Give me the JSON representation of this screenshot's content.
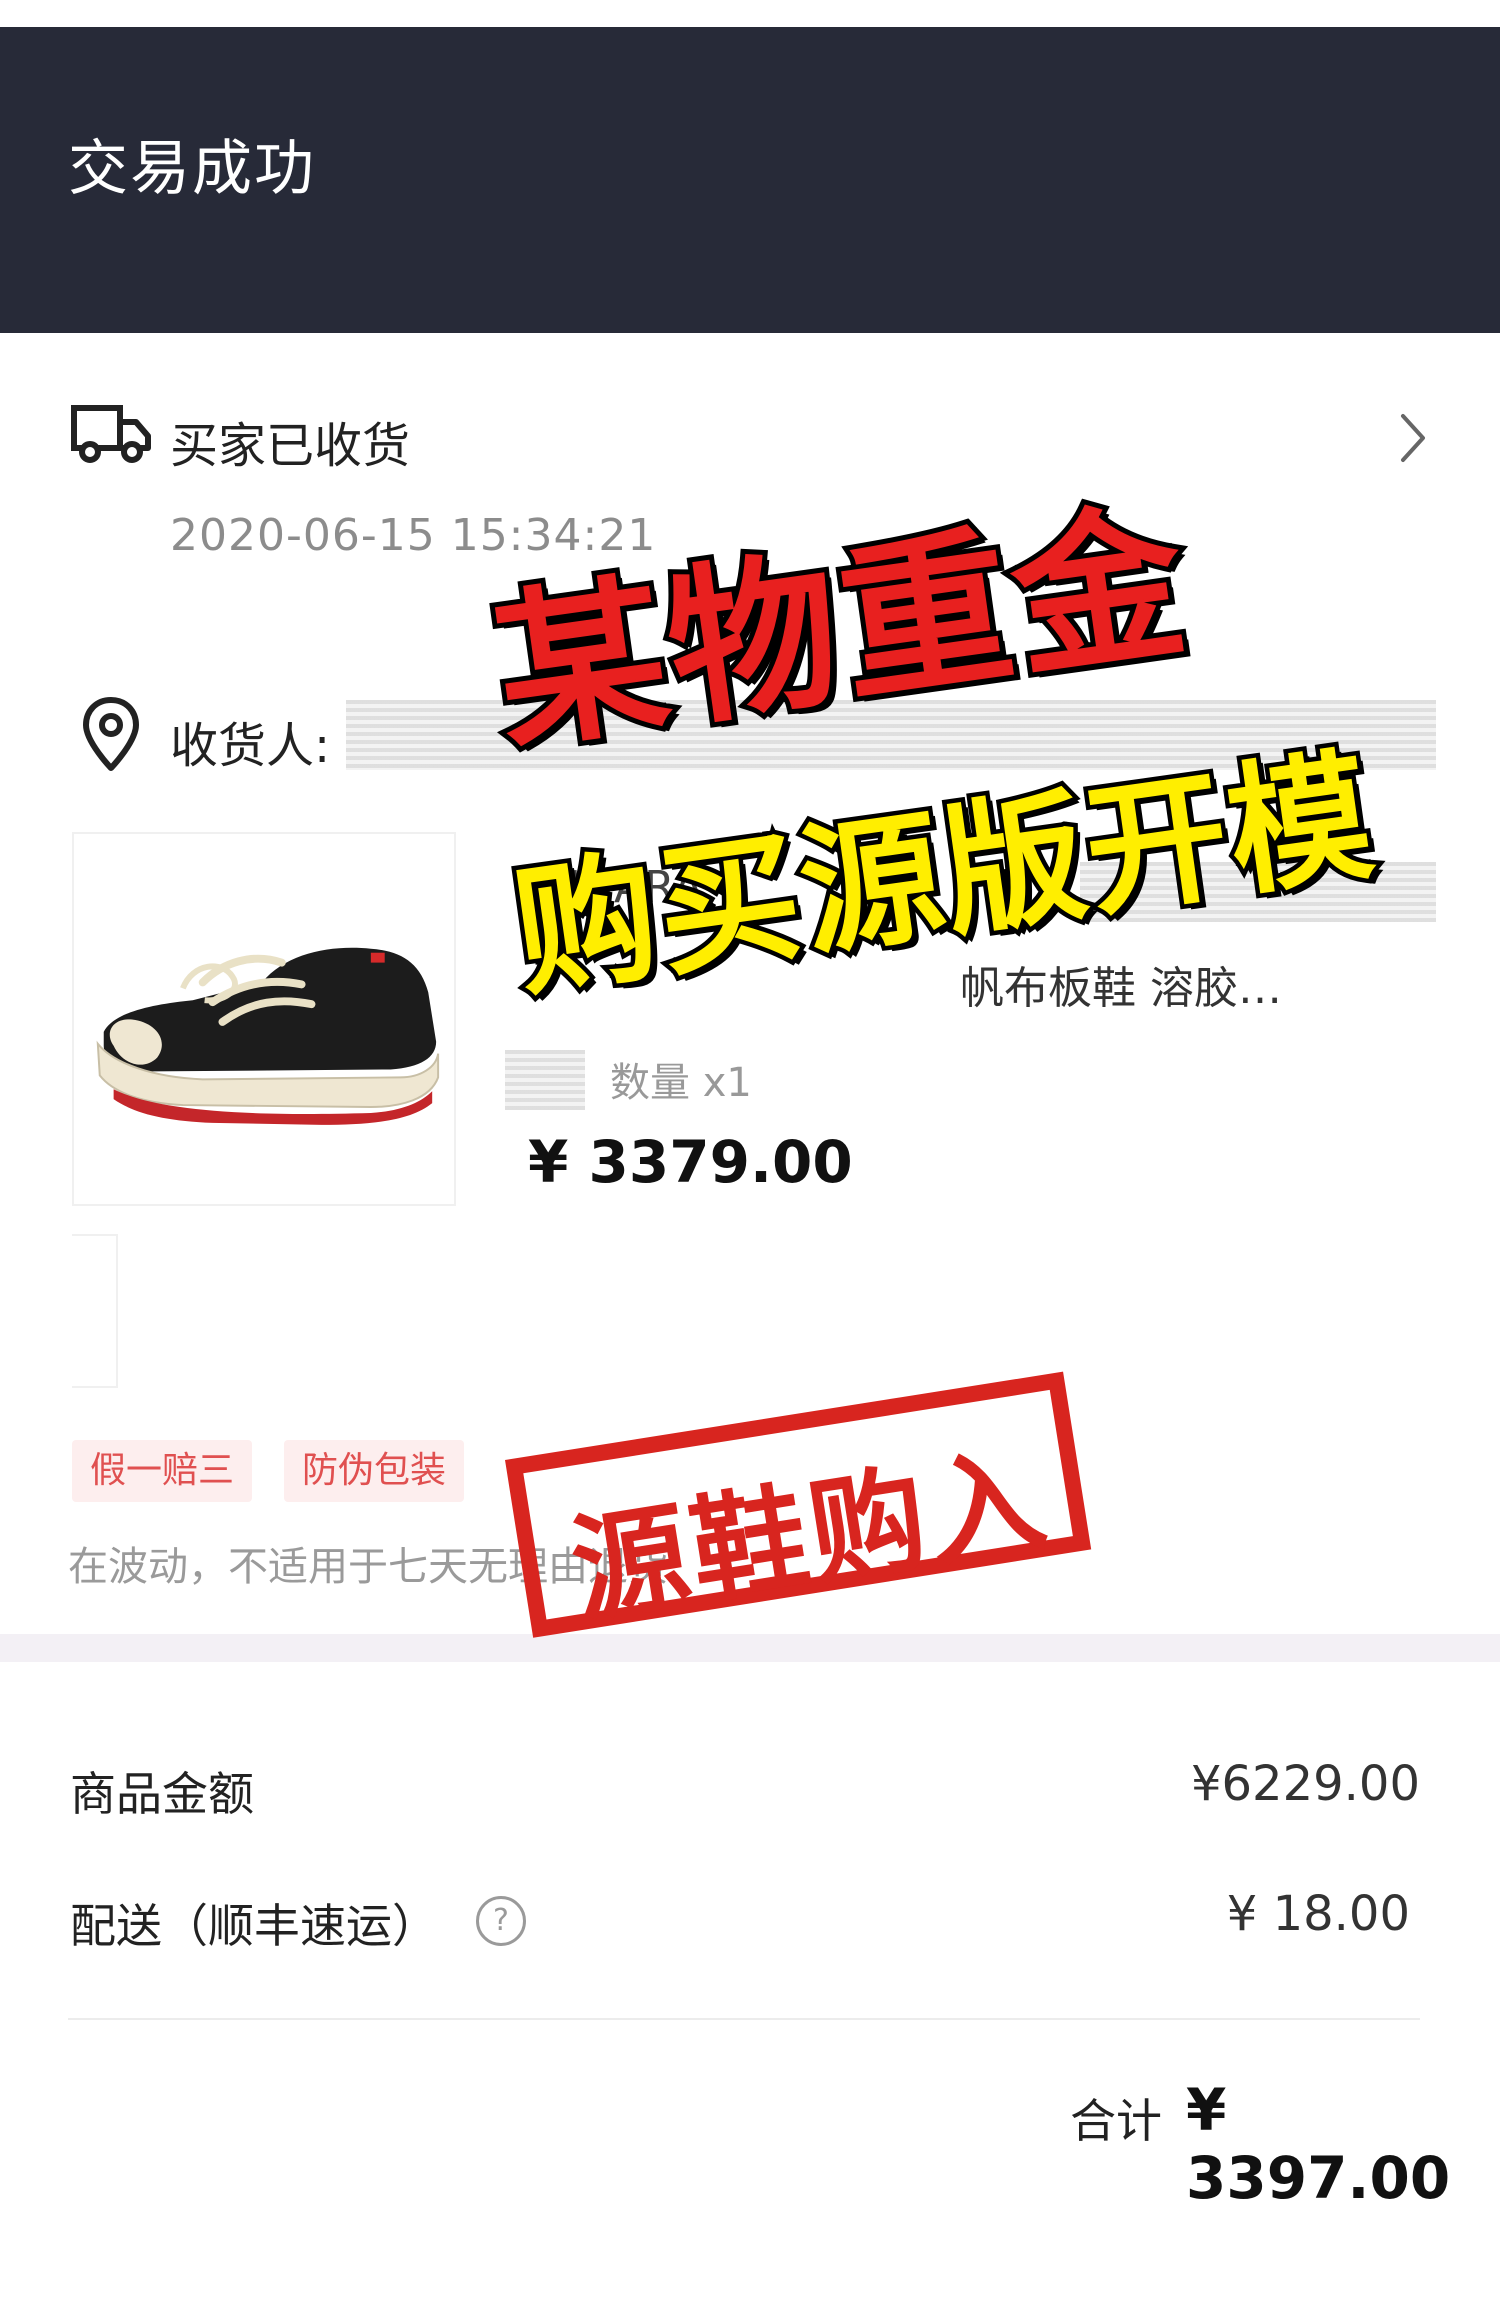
{
  "header": {
    "title": "交易成功"
  },
  "status": {
    "text": "买家已收货",
    "time": "2020-06-15 15:34:21"
  },
  "receiver": {
    "label": "收货人:"
  },
  "product": {
    "name_visible": "MIHARA",
    "name_line2": "帆布板鞋 溶胶…",
    "quantity": "数量 x1",
    "price": "¥ 3379.00"
  },
  "tags": [
    "假一赔三",
    "防伪包装"
  ],
  "policy_text": "在波动，不适用于七天无理由退货",
  "summary": {
    "goods_label": "商品金额",
    "goods_value": "¥6229.00",
    "shipping_label": "配送（顺丰速运）",
    "shipping_value": "¥ 18.00",
    "help_symbol": "?",
    "total_label": "合计",
    "total_value": "¥ 3397.00"
  },
  "overlay": {
    "line1": "某物重金",
    "line2": "购买源版开模",
    "stamp": "源鞋购入"
  },
  "colors": {
    "header_bg": "#272a38",
    "tag_bg": "#fdeeee",
    "tag_text": "#e05050",
    "overlay_red": "#e8201f",
    "overlay_yellow": "#ffee00"
  },
  "icons": [
    "truck-icon",
    "chevron-right-icon",
    "location-pin-icon",
    "help-icon"
  ]
}
